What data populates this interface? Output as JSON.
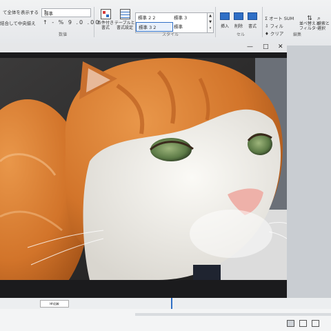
{
  "ribbon": {
    "wrap_text": "て全体を表示する",
    "merge_center": "結合して中央揃え",
    "number_format_value": "標準",
    "number_symbols": "↑ - % 9 .0 .00",
    "group_number": "数値",
    "group_styles": "スタイル",
    "group_cells": "セル",
    "group_edit": "編集",
    "conditional_format": "条件付き\n書式",
    "format_as_table": "テーブルとして\n書式設定",
    "styles": [
      "標準 2 2",
      "標準 3",
      "標準 3 2",
      "標準"
    ],
    "insert": "挿入",
    "delete": "削除",
    "format": "書式",
    "autosum": "Σ オート SUM",
    "fill": "⇩ フィル",
    "clear": "♦ クリア",
    "sort_filter": "並べ替えと\nフィルター",
    "find_select": "検索と\n選択"
  },
  "viewer": {
    "minimize": "—",
    "maximize": "□",
    "close": "✕"
  },
  "sheet": {
    "tab_label": "Hh比較"
  },
  "colors": {
    "accent": "#2f6fc6",
    "cat_orange": "#d7792c",
    "cat_white": "#f3f1ec",
    "eye_green": "#6d8a55"
  }
}
